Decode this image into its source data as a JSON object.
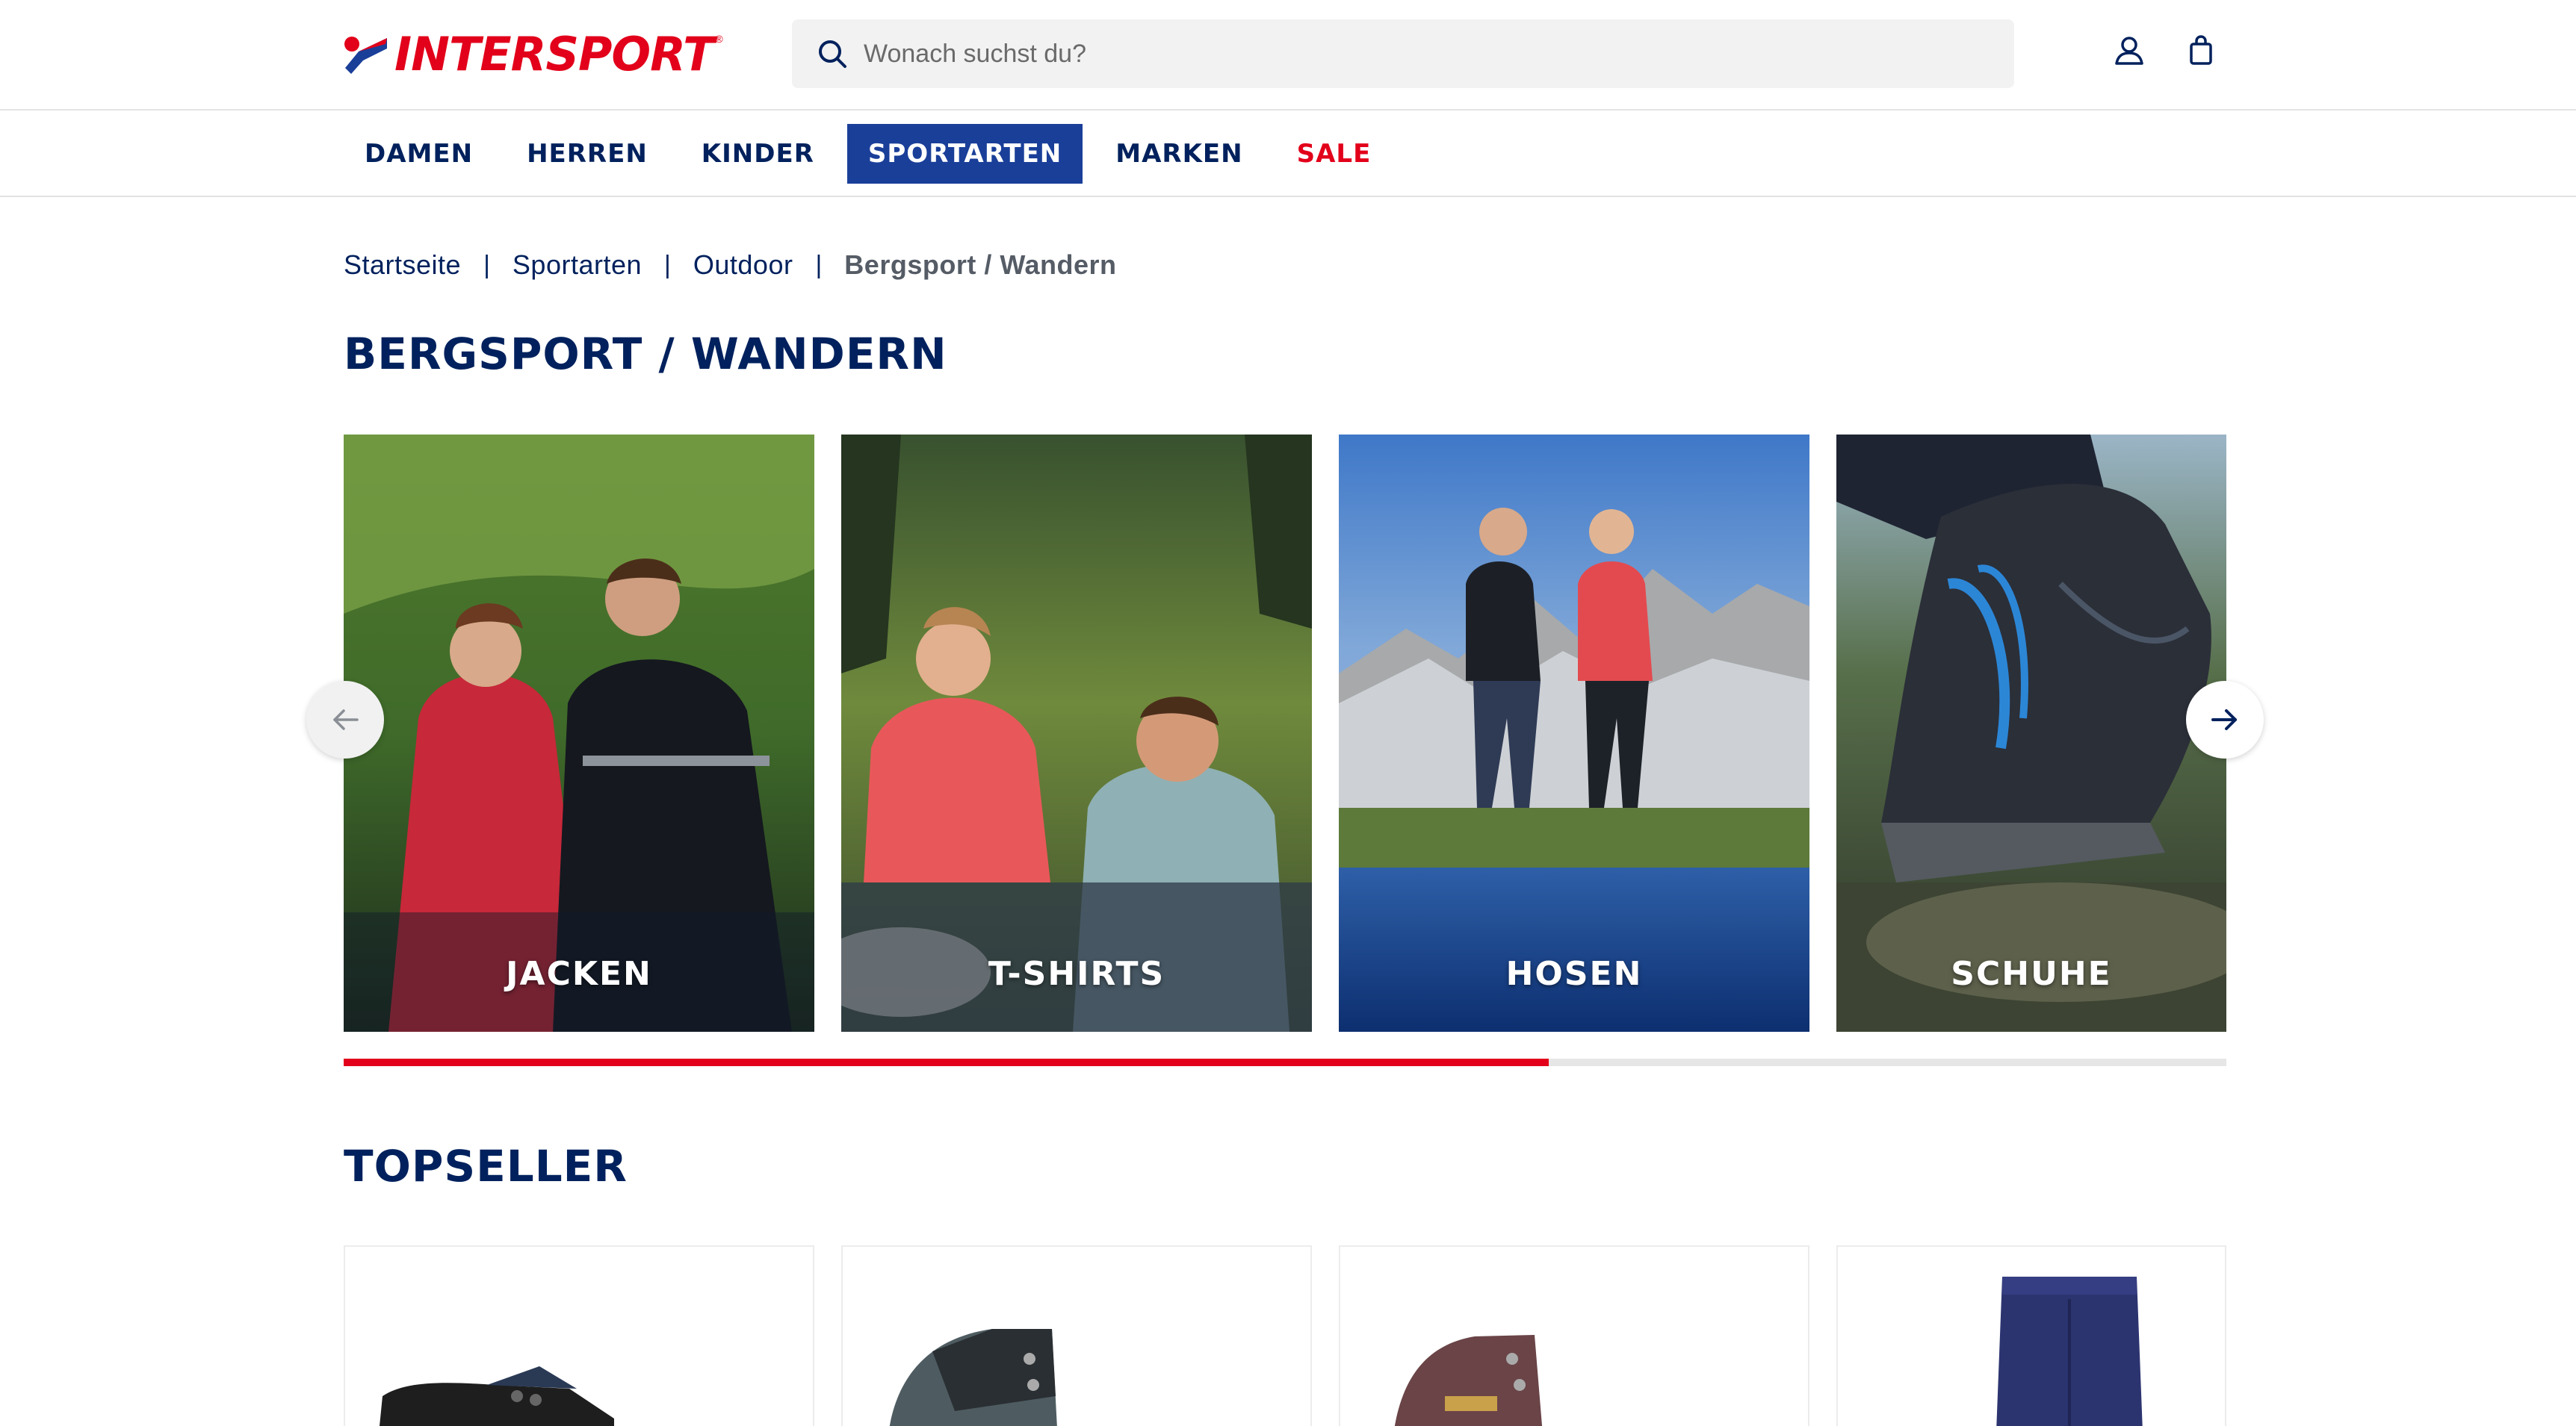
{
  "header": {
    "logo_text": "INTERSPORT",
    "logo_registered": "®",
    "search": {
      "placeholder": "Wonach suchst du?"
    },
    "icons": [
      "search-icon",
      "account-icon",
      "shopping-bag-icon"
    ]
  },
  "nav": {
    "items": [
      {
        "label": "DAMEN"
      },
      {
        "label": "HERREN"
      },
      {
        "label": "KINDER"
      },
      {
        "label": "SPORTARTEN",
        "active": true
      },
      {
        "label": "MARKEN"
      },
      {
        "label": "SALE",
        "highlight": "sale"
      }
    ]
  },
  "breadcrumb": {
    "items": [
      "Startseite",
      "Sportarten",
      "Outdoor",
      "Bergsport / Wandern"
    ],
    "separator": "|"
  },
  "page": {
    "title": "BERGSPORT / WANDERN"
  },
  "categories": {
    "cards": [
      {
        "label": "JACKEN"
      },
      {
        "label": "T-SHIRTS"
      },
      {
        "label": "HOSEN"
      },
      {
        "label": "SCHUHE"
      }
    ],
    "progress": 0.64
  },
  "topseller": {
    "title": "TOPSELLER",
    "products": [
      "hiking-shoe",
      "trekking-boot",
      "hiking-boot",
      "hiking-pants"
    ]
  },
  "colors": {
    "brand_blue": "#00215d",
    "active_nav": "#1a3f99",
    "brand_red": "#e2001a"
  }
}
